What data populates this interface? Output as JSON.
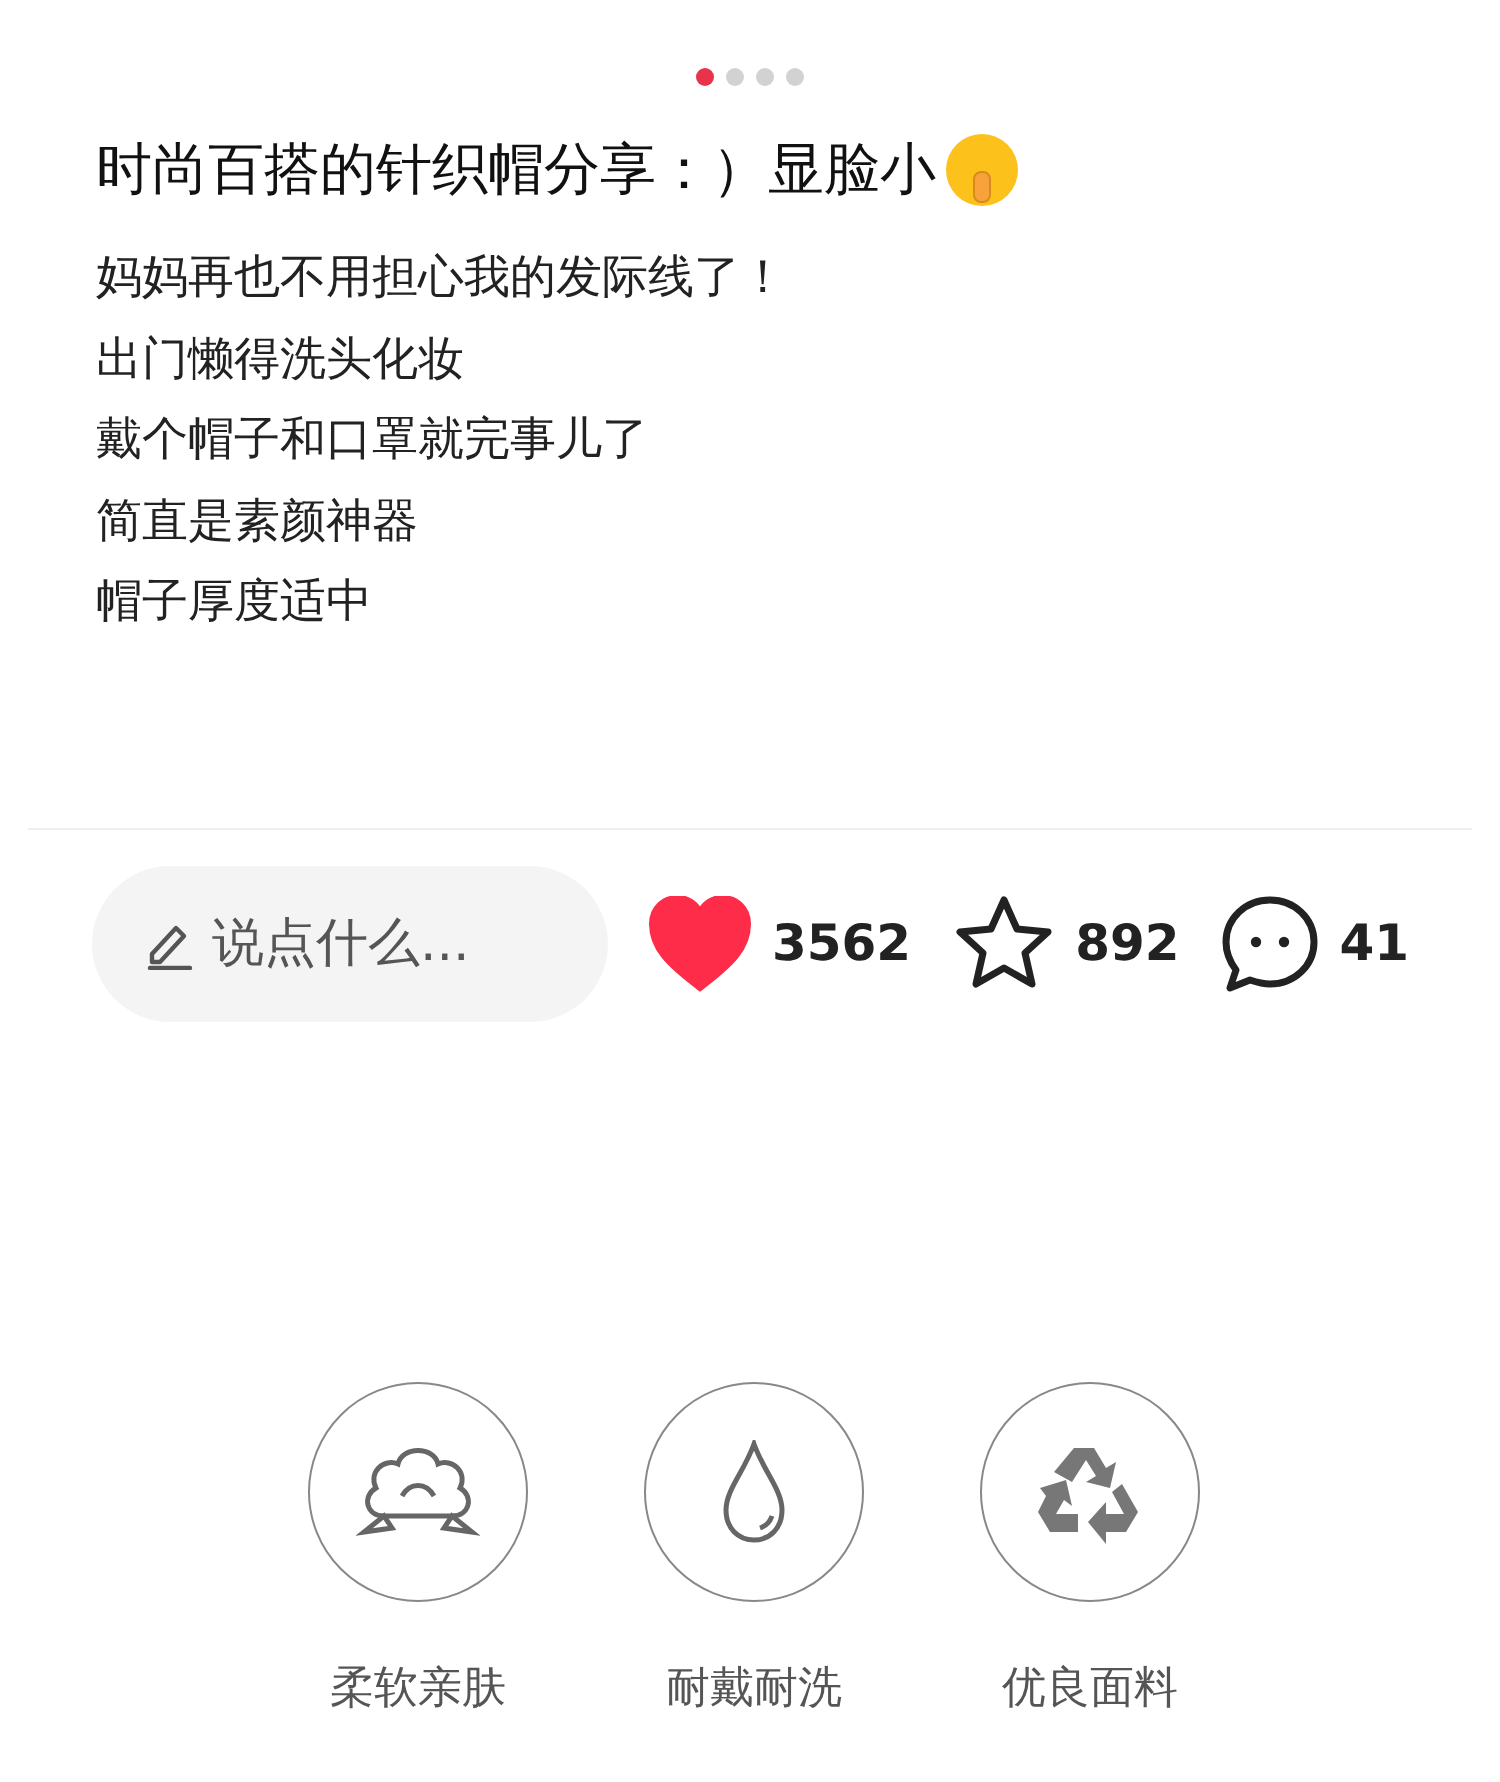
{
  "pager": [
    {
      "selected": true
    },
    {
      "selected": false
    },
    {
      "selected": false
    },
    {
      "selected": false
    }
  ],
  "title": "时尚百搭的针织帽分享：）显脸小",
  "body": [
    "妈妈再也不用担心我的发际线了！",
    "出门懒得洗头化妆",
    "戴个帽子和口罩就完事儿了",
    "简直是素颜神器",
    "帽子厚度适中"
  ],
  "comment_field": {
    "placeholder": "说点什么..."
  },
  "actions": [
    {
      "kind": "like",
      "count": "3562",
      "active": true
    },
    {
      "kind": "star",
      "count": "892",
      "active": false
    },
    {
      "kind": "comment",
      "count": "41"
    }
  ],
  "features": [
    {
      "kind": "cotton",
      "label": "柔软亲肤"
    },
    {
      "kind": "drop",
      "label": "耐戴耐洗"
    },
    {
      "kind": "recycle",
      "label": "优良面料"
    }
  ]
}
